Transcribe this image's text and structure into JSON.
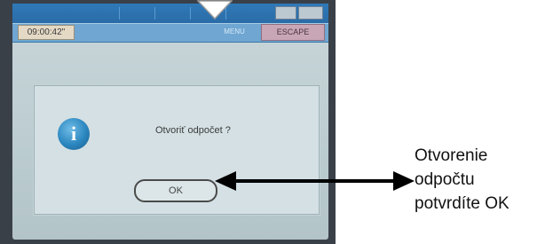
{
  "screen": {
    "clock": "09:00:42\"",
    "menu_label": "MENU",
    "escape_label": "ESCAPE"
  },
  "dialog": {
    "question": "Otvoriť odpočet ?",
    "ok_label": "OK",
    "icon": "info-icon"
  },
  "annotation": {
    "lines": [
      "Otvorenie",
      "odpočtu",
      "potvrdíte OK"
    ]
  }
}
